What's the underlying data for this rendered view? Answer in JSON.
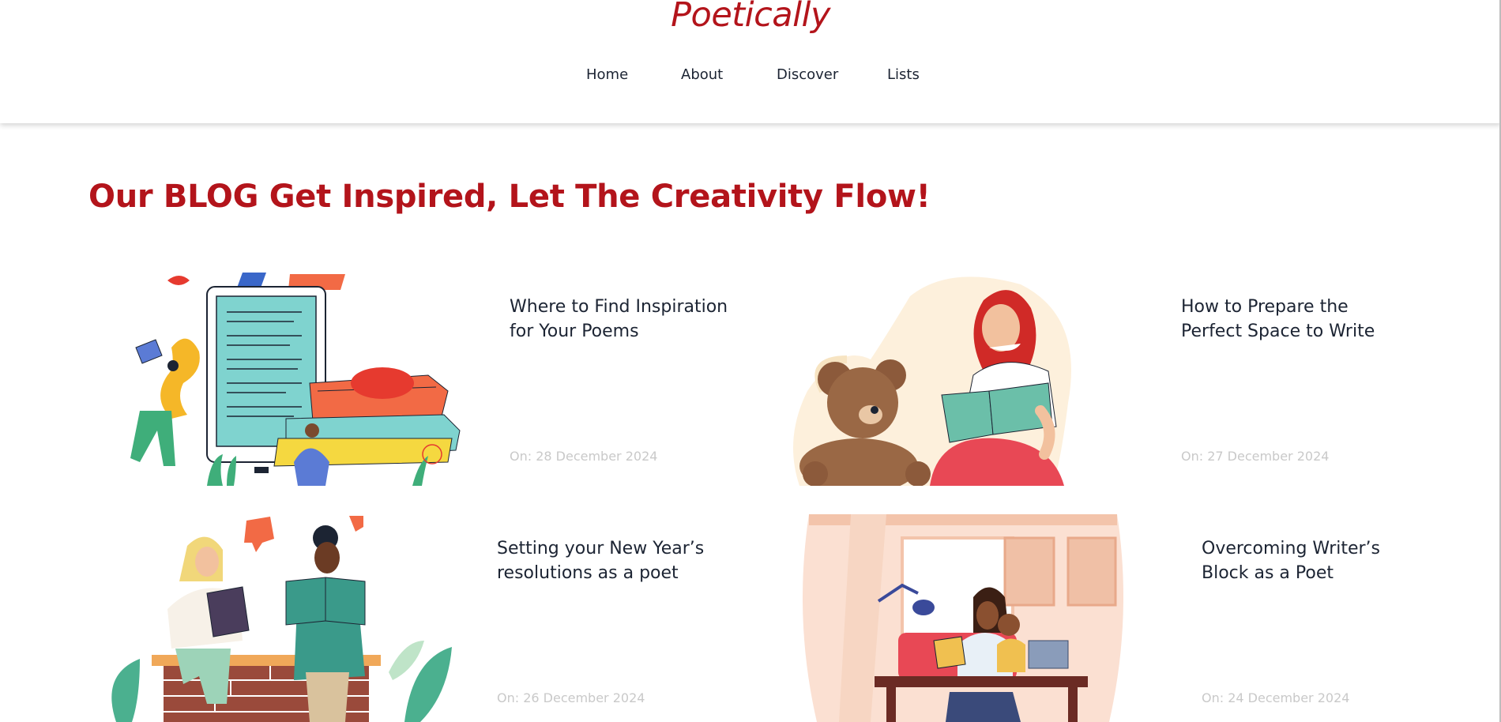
{
  "site": {
    "logo": "Poetically",
    "nav": [
      "Home",
      "About",
      "Discover",
      "Lists"
    ]
  },
  "blog": {
    "heading": "Our BLOG Get Inspired, Let The Creativity Flow!",
    "posts": [
      {
        "title": "Where to Find Inspiration for Your Poems",
        "date": "On: 28 December 2024",
        "image": "illustration-books-and-reader"
      },
      {
        "title": "How to Prepare the Perfect Space to Write",
        "date": "On: 27 December 2024",
        "image": "illustration-woman-reading-with-teddy"
      },
      {
        "title": "Setting your New Year’s resolutions as a poet",
        "date": "On: 26 December 2024",
        "image": "illustration-two-women-reading"
      },
      {
        "title": "Overcoming Writer’s Block as a Poet",
        "date": "On: 24 December 2024",
        "image": "illustration-mother-child-desk"
      }
    ]
  },
  "colors": {
    "brand": "#b3141b",
    "text": "#1c2433",
    "date": "#c9c9c9"
  }
}
